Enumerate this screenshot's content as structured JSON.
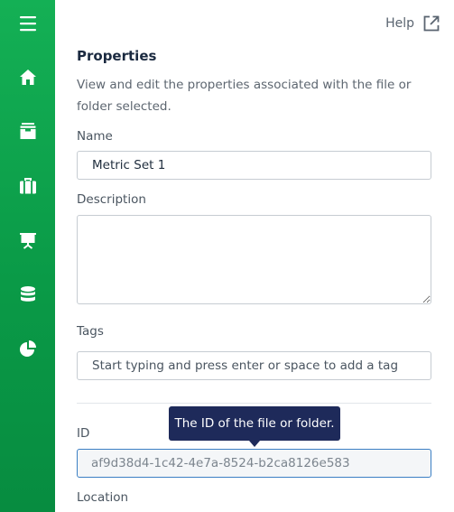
{
  "sidebar": {
    "items": [
      {
        "icon": "menu-icon"
      },
      {
        "icon": "home-icon"
      },
      {
        "icon": "archive-icon"
      },
      {
        "icon": "briefcase-icon"
      },
      {
        "icon": "presentation-icon"
      },
      {
        "icon": "database-icon"
      },
      {
        "icon": "pie-chart-icon"
      }
    ],
    "colors": {
      "top": "#14b055",
      "bottom": "#078c40",
      "icon": "#ffffff"
    }
  },
  "header": {
    "help_label": "Help",
    "help_icon": "external-link-icon"
  },
  "properties": {
    "title": "Properties",
    "description": "View and edit the properties associated with the file or folder selected.",
    "name_label": "Name",
    "name_value": "Metric Set 1",
    "description_label": "Description",
    "description_value": "",
    "tags_label": "Tags",
    "tags_placeholder": "Start typing and press enter or space to add a tag",
    "id_label": "ID",
    "id_value": "af9d38d4-1c42-4e7a-8524-b2ca8126e583",
    "id_tooltip": "The ID of the file or folder.",
    "location_label": "Location"
  },
  "colors": {
    "accent": "#3b7fc4",
    "tooltip_bg": "#1e2a5a"
  }
}
